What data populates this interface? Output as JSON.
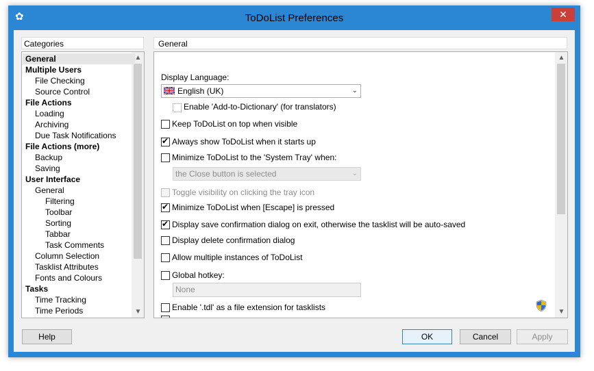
{
  "window": {
    "title": "ToDoList Preferences",
    "app_icon": "gear-icon",
    "close_icon": "close-icon"
  },
  "categories": {
    "header": "Categories",
    "items": [
      {
        "label": "General",
        "level": 0,
        "bold": true,
        "selected": true
      },
      {
        "label": "Multiple Users",
        "level": 0,
        "bold": true
      },
      {
        "label": "File Checking",
        "level": 1
      },
      {
        "label": "Source Control",
        "level": 1
      },
      {
        "label": "File Actions",
        "level": 0,
        "bold": true
      },
      {
        "label": "Loading",
        "level": 1
      },
      {
        "label": "Archiving",
        "level": 1
      },
      {
        "label": "Due Task Notifications",
        "level": 1
      },
      {
        "label": "File Actions (more)",
        "level": 0,
        "bold": true
      },
      {
        "label": "Backup",
        "level": 1
      },
      {
        "label": "Saving",
        "level": 1
      },
      {
        "label": "User Interface",
        "level": 0,
        "bold": true
      },
      {
        "label": "General",
        "level": 1
      },
      {
        "label": "Filtering",
        "level": 2
      },
      {
        "label": "Toolbar",
        "level": 2
      },
      {
        "label": "Sorting",
        "level": 2
      },
      {
        "label": "Tabbar",
        "level": 2
      },
      {
        "label": "Task Comments",
        "level": 2
      },
      {
        "label": "Column Selection",
        "level": 1
      },
      {
        "label": "Tasklist Attributes",
        "level": 1
      },
      {
        "label": "Fonts and Colours",
        "level": 1
      },
      {
        "label": "Tasks",
        "level": 0,
        "bold": true
      },
      {
        "label": "Time Tracking",
        "level": 1
      },
      {
        "label": "Time Periods",
        "level": 1
      }
    ]
  },
  "general": {
    "header": "General",
    "display_language_label": "Display Language:",
    "language_value": "English (UK)",
    "enable_dictionary": "Enable 'Add-to-Dictionary' (for translators)",
    "keep_on_top": "Keep ToDoList on top when visible",
    "always_show": "Always show ToDoList when it starts up",
    "minimize_tray": "Minimize ToDoList to the 'System Tray' when:",
    "tray_option": "the Close button is selected",
    "toggle_visibility": "Toggle visibility on clicking the tray icon",
    "minimize_escape": "Minimize ToDoList when [Escape] is pressed",
    "save_confirm": "Display save confirmation dialog on exit, otherwise the tasklist will be auto-saved",
    "delete_confirm": "Display delete confirmation dialog",
    "multiple_instances": "Allow multiple instances of ToDoList",
    "global_hotkey": "Global hotkey:",
    "hotkey_value": "None",
    "tdl_extension": "Enable '.tdl' as a file extension for tasklists",
    "checked": {
      "enable_dictionary": false,
      "keep_on_top": false,
      "always_show": true,
      "minimize_tray": false,
      "toggle_visibility": false,
      "minimize_escape": true,
      "save_confirm": true,
      "delete_confirm": false,
      "multiple_instances": false,
      "global_hotkey": false,
      "tdl_extension": false
    },
    "shield_icon": "uac-shield-icon"
  },
  "buttons": {
    "help": "Help",
    "ok": "OK",
    "cancel": "Cancel",
    "apply": "Apply"
  }
}
